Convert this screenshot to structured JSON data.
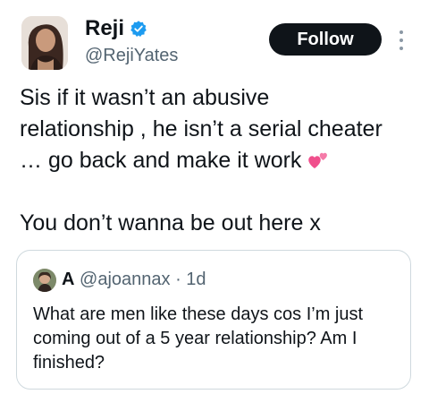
{
  "author": {
    "display_name": "Reji",
    "handle": "@RejiYates",
    "verified": true
  },
  "follow_button_label": "Follow",
  "tweet_lines": [
    "Sis if it wasn’t an abusive",
    "relationship , he isn’t a serial cheater",
    "… go back and make it work",
    "You don’t wanna be out here x"
  ],
  "tweet_emoji": "two-hearts-icon",
  "quoted_tweet": {
    "display_name": "A",
    "handle": "@ajoannax",
    "separator": "·",
    "time": "1d",
    "lines": [
      "What are men like these days cos I’m just",
      "coming out of a 5 year relationship? Am I",
      "finished?"
    ]
  },
  "colors": {
    "verified_blue": "#1d9bf0",
    "follow_bg": "#0f1419",
    "heart_pink": "#f04f8c",
    "secondary_text": "#536471",
    "border": "#cfd9de"
  }
}
